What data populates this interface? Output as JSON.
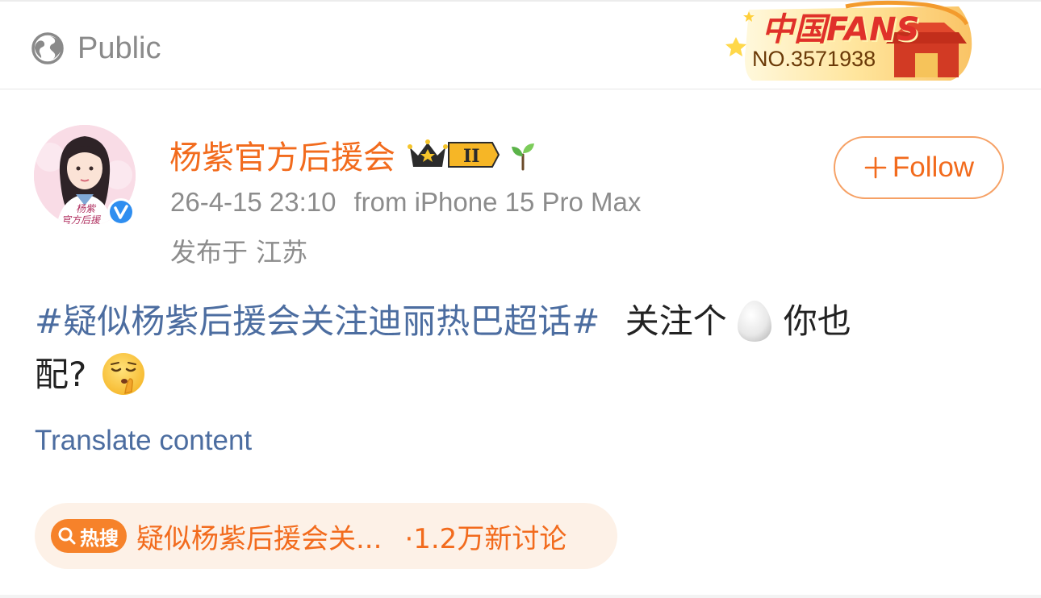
{
  "header": {
    "visibility_label": "Public",
    "fans_badge": {
      "title": "中国FANS",
      "number": "NO.3571938"
    }
  },
  "post": {
    "author": {
      "name": "杨紫官方后援会",
      "avatar_caption": "杨紫\n官方后援"
    },
    "timestamp": "26-4-15 23:10",
    "source": "from iPhone 15 Pro Max",
    "location": "发布于 江苏",
    "follow_label": "Follow",
    "content": {
      "hashtag": "#疑似杨紫后援会关注迪丽热巴超话#",
      "text_part1": "关注个",
      "text_part2": "你也",
      "text_part3": "配?",
      "emojis": [
        "egg-icon",
        "shush-face-icon"
      ]
    },
    "translate_label": "Translate content",
    "hot_search": {
      "tag_label": "热搜",
      "topic": "疑似杨紫后援会关...",
      "discussion_count": "·1.2万新讨论"
    }
  },
  "colors": {
    "accent_orange": "#f26b1d",
    "link_blue": "#4c6da0",
    "meta_gray": "#8c8c8c"
  }
}
